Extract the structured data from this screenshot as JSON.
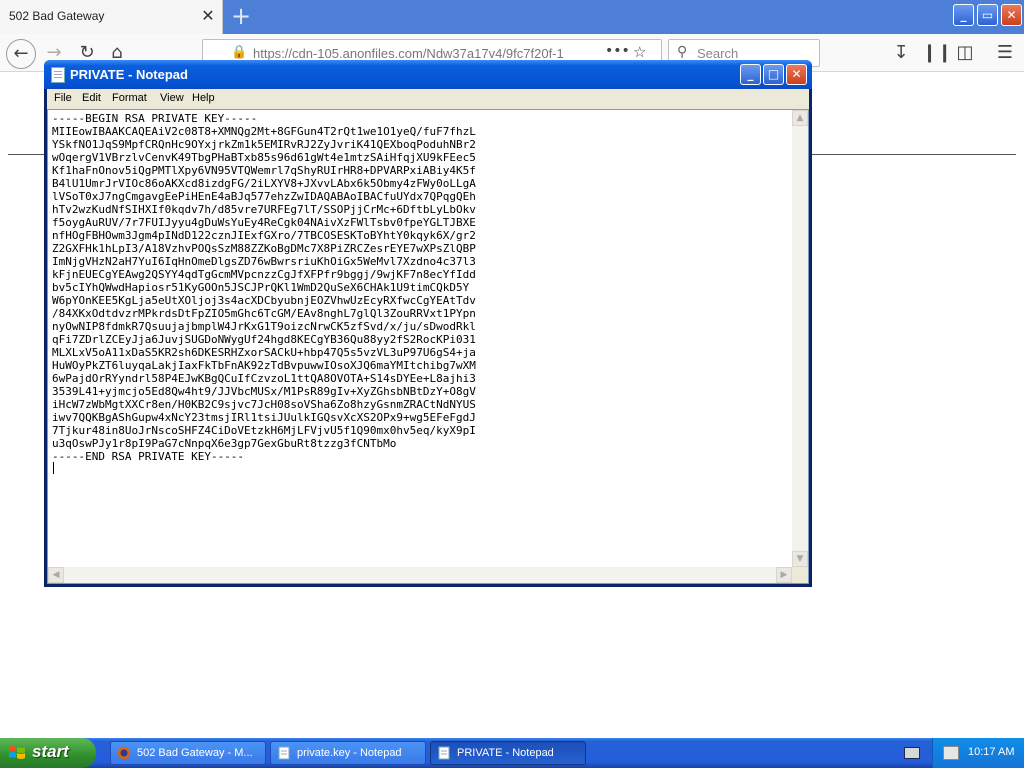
{
  "browser": {
    "tab_title": "502 Bad Gateway",
    "tab_close": "✕",
    "new_tab": "+",
    "url": "https://cdn-105.anonfiles.com/Ndw37a17v4/9fc7f20f-1",
    "url_more": "•••",
    "search_placeholder": "Search",
    "window_controls": {
      "min": "_",
      "max": "▭",
      "close": "✕"
    }
  },
  "notepad": {
    "title": "PRIVATE - Notepad",
    "controls": {
      "min": "_",
      "max": "□",
      "close": "✕"
    },
    "menu": [
      "File",
      "Edit",
      "Format",
      "View",
      "Help"
    ],
    "content": "-----BEGIN RSA PRIVATE KEY-----\nMIIEowIBAAKCAQEAiV2c08T8+XMNQg2Mt+8GFGun4T2rQt1we1O1yeQ/fuF7fhzL\nYSkfNO1JqS9MpfCRQnHc9OYxjrkZm1k5EMIRvRJ2ZyJvriK41QEXboqPoduhNBr2\nwOqergV1VBrzlvCenvK49TbgPHaBTxb85s96d61gWt4e1mtzSAiHfqjXU9kFEec5\nKf1haFnOnov5iQgPMTlXpy6VN95VTQWemrl7qShyRUIrHR8+DPVARPxiABiy4K5f\nB4lU1UmrJrVIOc86oAKXcd8izdgFG/2iLXYV8+JXvvLAbx6k5Obmy4zFWy0oLLgA\nlVSoT0xJ7ngCmgavgEePiHEnE4aBJq577ehzZwIDAQABAoIBACfuUYdx7QPqgQEh\nhTv2wzKudNfSIHXIf0kqdv7h/d85vre7URFEg7lT/SSOPjjCrMc+6DftbLyLbOkv\nf5oygAuRUV/7r7FUIJyyu4gDuWsYuEy4ReCgk04NAivXzFWlTsbv0fpeYGLTJBXE\nnfHOgFBHOwm3Jgm4pINdD122cznJIExfGXro/7TBCOSESKToBYhtY0kqyk6X/gr2\nZ2GXFHk1hLpI3/A18VzhvPOQsSzM88ZZKoBgDMc7X8PiZRCZesrEYE7wXPsZlQBP\nImNjgVHzN2aH7YuI6IqHnOmeDlgsZD76wBwrsriuKhOiGx5WeMvl7Xzdno4c37l3\nkFjnEUECgYEAwg2QSYY4qdTgGcmMVpcnzzCgJfXFPfr9bggj/9wjKF7n8ecYfIdd\nbv5cIYhQWwdHapiosr51KyGOOn5JSCJPrQKl1WmD2QuSeX6CHAk1U9timCQkD5Y\nW6pYOnKEE5KgLja5eUtXOljoj3s4acXDCbyubnjEOZVhwUzEcyRXfwcCgYEAtTdv\n/84XKxOdtdvzrMPkrdsDtFpZIO5mGhc6TcGM/EAv8nghL7glQl3ZouRRVxt1PYpn\nnyOwNIP8fdmkR7QsuujajbmplW4JrKxG1T9oizcNrwCK5zfSvd/x/ju/sDwodRkl\nqFi7ZDrlZCEyJja6JuvjSUGDoNWygUf24hgd8KECgYB36Qu88yy2fS2RocKPi031\nMLXLxV5oA11xDaS5KR2sh6DKESRHZxorSACkU+hbp47Q5s5vzVL3uP97U6gS4+ja\nHuWOyPkZT6luyqaLakjIaxFkTbFnAK92zTdBvpuwwIOsoXJQ6maYMItchibg7wXM\n6wPajdOrRYyndrl58P4EJwKBgQCuIfCzvzoL1ttQA8OVOTA+S14sDYEe+L8ajhi3\n3539L41+yjmcjo5Ed8Qw4ht9/JJVbcMUSx/M1PsR89gIv+XyZGhsbNBtDzY+O8gV\niHcW7zWbMgtXXCr8en/H0KB2C9sjvc7JcH08soVSha6Zo8hzyGsnmZRACtNdNYUS\niwv7QQKBgAShGupw4xNcY23tmsjIRl1tsiJUulkIGQsvXcXS2OPx9+wg5EFeFgdJ\n7Tjkur48in8UoJrNscoSHFZ4CiDoVEtzkH6MjLFVjvU5f1Q90mx0hv5eq/kyX9pI\nu3qOswPJy1r8pI9PaG7cNnpqX6e3gp7GexGbuRt8tzzg3fCNTbMo\n-----END RSA PRIVATE KEY-----"
  },
  "taskbar": {
    "start_label": "start",
    "tasks": [
      {
        "label": "502 Bad Gateway - M...",
        "active": false
      },
      {
        "label": "private.key - Notepad",
        "active": false
      },
      {
        "label": "PRIVATE - Notepad",
        "active": true
      }
    ],
    "clock": "10:17 AM"
  }
}
